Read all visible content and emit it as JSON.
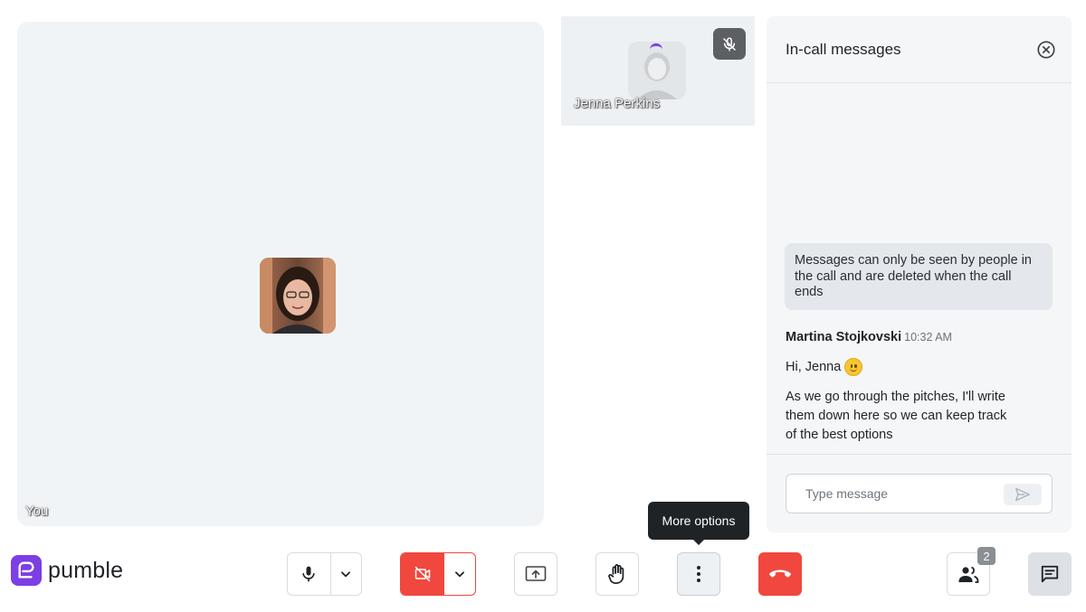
{
  "self_tile": {
    "name": "You"
  },
  "remote_tile": {
    "name": "Jenna Perkins",
    "mic_status": "muted"
  },
  "chat": {
    "title": "In-call messages",
    "notice": "Messages can only be seen by people in the call and are deleted when the call ends",
    "messages": [
      {
        "author": "Martina Stojkovski",
        "time": "10:32 AM",
        "lines": [
          "Hi, Jenna",
          "As we go through the pitches, I'll write them down here so we can keep track of the best options"
        ]
      }
    ],
    "input": {
      "placeholder": "Type message",
      "value": ""
    }
  },
  "brand": {
    "name": "pumble",
    "color": "#7b3fe4"
  },
  "toolbar": {
    "tooltip": "More options",
    "participants_count": "2",
    "icons": [
      "mic-icon",
      "chevron-down-icon",
      "camera-off-icon",
      "share-screen-icon",
      "raise-hand-icon",
      "more-vertical-icon",
      "hang-up-icon",
      "participants-icon",
      "chat-icon"
    ]
  },
  "colors": {
    "danger": "#f0483e",
    "tile_bg": "#f1f4f7",
    "tooltip_bg": "#1f2326"
  }
}
